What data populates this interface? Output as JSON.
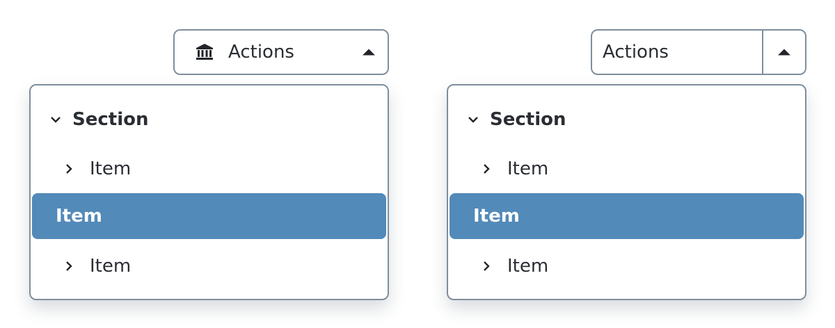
{
  "left": {
    "button": {
      "label": "Actions",
      "icon": "bank-icon",
      "caret": "caret-up-icon"
    },
    "menu": {
      "section": {
        "label": "Section",
        "icon": "chevron-down-icon"
      },
      "items": [
        {
          "label": "Item",
          "icon": "chevron-right-icon"
        },
        {
          "label": "Item",
          "selected": true
        },
        {
          "label": "Item",
          "icon": "chevron-right-icon"
        }
      ]
    }
  },
  "right": {
    "button": {
      "label": "Actions",
      "caret": "caret-up-icon",
      "split": true
    },
    "menu": {
      "section": {
        "label": "Section",
        "icon": "chevron-down-icon"
      },
      "items": [
        {
          "label": "Item",
          "icon": "chevron-right-icon"
        },
        {
          "label": "Item",
          "selected": true
        },
        {
          "label": "Item",
          "icon": "chevron-right-icon"
        }
      ]
    }
  },
  "colors": {
    "border": "#7f8e9c",
    "selected_bg": "#528ab9",
    "selected_text": "#ffffff",
    "text": "#2a2d33"
  }
}
